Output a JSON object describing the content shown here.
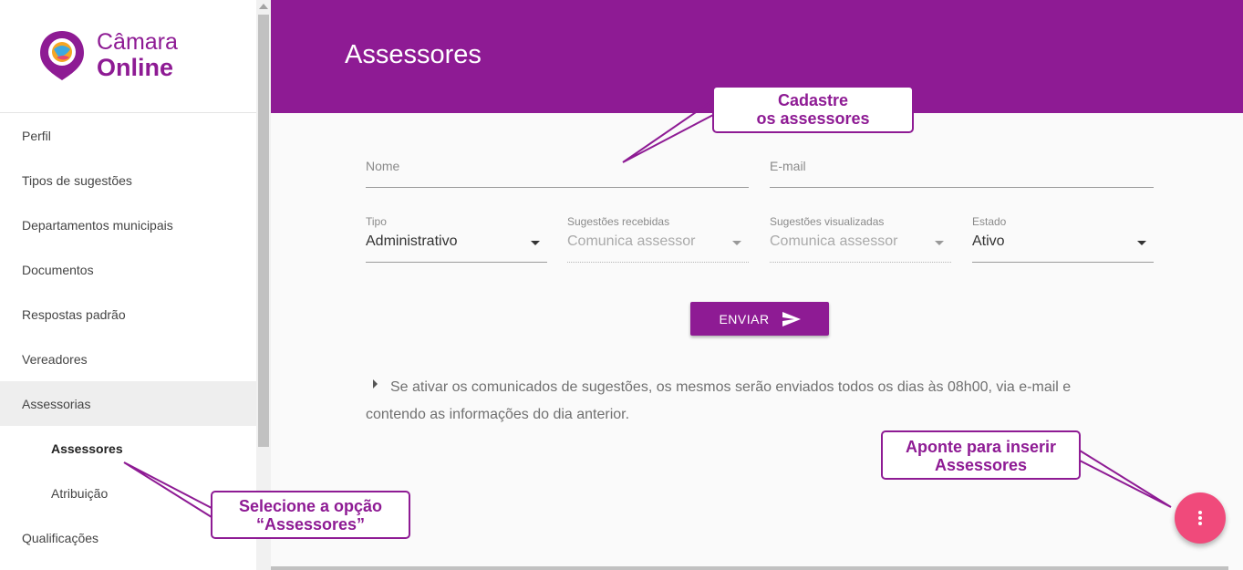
{
  "app": {
    "logo_line1": "Câmara",
    "logo_line2": "Online",
    "brand_color": "#8e1b94",
    "fab_color": "#f04a7b"
  },
  "sidebar": {
    "items": [
      {
        "label": "Perfil"
      },
      {
        "label": "Tipos de sugestões"
      },
      {
        "label": "Departamentos municipais"
      },
      {
        "label": "Documentos"
      },
      {
        "label": "Respostas padrão"
      },
      {
        "label": "Vereadores"
      },
      {
        "label": "Assessorias"
      },
      {
        "label": "Assessores"
      },
      {
        "label": "Atribuição"
      },
      {
        "label": "Qualificações"
      }
    ]
  },
  "header": {
    "title": "Assessores"
  },
  "form": {
    "name_placeholder": "Nome",
    "email_placeholder": "E-mail",
    "tipo": {
      "label": "Tipo",
      "value": "Administrativo"
    },
    "recebidas": {
      "label": "Sugestões recebidas",
      "value": "Comunica assessor"
    },
    "visualizadas": {
      "label": "Sugestões visualizadas",
      "value": "Comunica assessor"
    },
    "estado": {
      "label": "Estado",
      "value": "Ativo"
    },
    "send_label": "ENVIAR"
  },
  "info_text": "Se ativar os comunicados de sugestões, os mesmos serão enviados todos os dias às 08h00, via e-mail e contendo as informações do dia anterior.",
  "callouts": {
    "cadastre": {
      "line1": "Cadastre",
      "line2": "os assessores"
    },
    "aponte": {
      "line1": "Aponte para inserir",
      "line2": "Assessores"
    },
    "selecione": {
      "line1": "Selecione a opção",
      "line2": "“Assessores”"
    }
  }
}
